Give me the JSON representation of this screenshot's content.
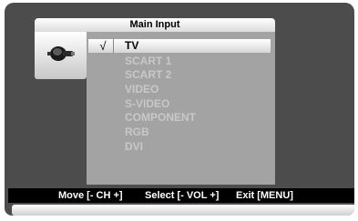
{
  "menu": {
    "title": "Main Input",
    "icon": "input-connector-icon",
    "check_mark": "√",
    "items": [
      {
        "label": "TV",
        "selected": true
      },
      {
        "label": "SCART 1",
        "selected": false
      },
      {
        "label": "SCART 2",
        "selected": false
      },
      {
        "label": "VIDEO",
        "selected": false
      },
      {
        "label": "S-VIDEO",
        "selected": false
      },
      {
        "label": "COMPONENT",
        "selected": false
      },
      {
        "label": "RGB",
        "selected": false
      },
      {
        "label": "DVI",
        "selected": false
      }
    ]
  },
  "footer": {
    "move": "Move [- CH +]",
    "select": "Select [- VOL +]",
    "exit": "Exit [MENU]"
  },
  "colors": {
    "panel_bg": "#4c4c4c",
    "list_bg": "#a3a3a3",
    "unselected_text": "#c8c8c8",
    "footer_bg": "#000000"
  }
}
